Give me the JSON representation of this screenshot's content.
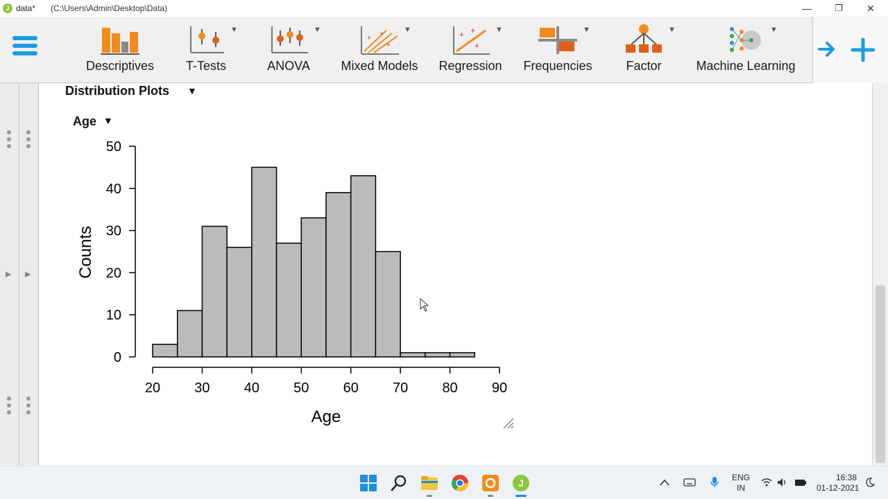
{
  "window": {
    "title": "data*",
    "path": "(C:\\Users\\Admin\\Desktop\\Data)",
    "minimize": "—",
    "restore": "❐",
    "close": "✕"
  },
  "ribbon": {
    "tools": [
      {
        "label": "Descriptives",
        "icon": "descriptives-icon"
      },
      {
        "label": "T-Tests",
        "icon": "t-tests-icon"
      },
      {
        "label": "ANOVA",
        "icon": "anova-icon"
      },
      {
        "label": "Mixed Models",
        "icon": "mixed-models-icon"
      },
      {
        "label": "Regression",
        "icon": "regression-icon"
      },
      {
        "label": "Frequencies",
        "icon": "frequencies-icon"
      },
      {
        "label": "Factor",
        "icon": "factor-icon"
      },
      {
        "label": "Machine Learning",
        "icon": "machine-learning-icon"
      }
    ],
    "accent": "#1d9be0",
    "orange": "#f08c1e"
  },
  "results": {
    "section_title": "Distribution Plots",
    "plot_title": "Age"
  },
  "chart_data": {
    "type": "bar",
    "title": "",
    "xlabel": "Age",
    "ylabel": "Counts",
    "bin_edges": [
      20,
      25,
      30,
      35,
      40,
      45,
      50,
      55,
      60,
      65,
      70,
      75,
      80,
      85
    ],
    "values": [
      3,
      11,
      31,
      26,
      45,
      27,
      33,
      39,
      43,
      25,
      1,
      1,
      1
    ],
    "xlim": [
      20,
      90
    ],
    "ylim": [
      0,
      50
    ],
    "xticks": [
      20,
      30,
      40,
      50,
      60,
      70,
      80,
      90
    ],
    "yticks": [
      0,
      10,
      20,
      30,
      40,
      50
    ],
    "bar_color": "#bbbbbb",
    "grid": false
  },
  "taskbar": {
    "lang1": "ENG",
    "lang2": "IN",
    "time": "16:38",
    "date": "01-12-2021"
  }
}
